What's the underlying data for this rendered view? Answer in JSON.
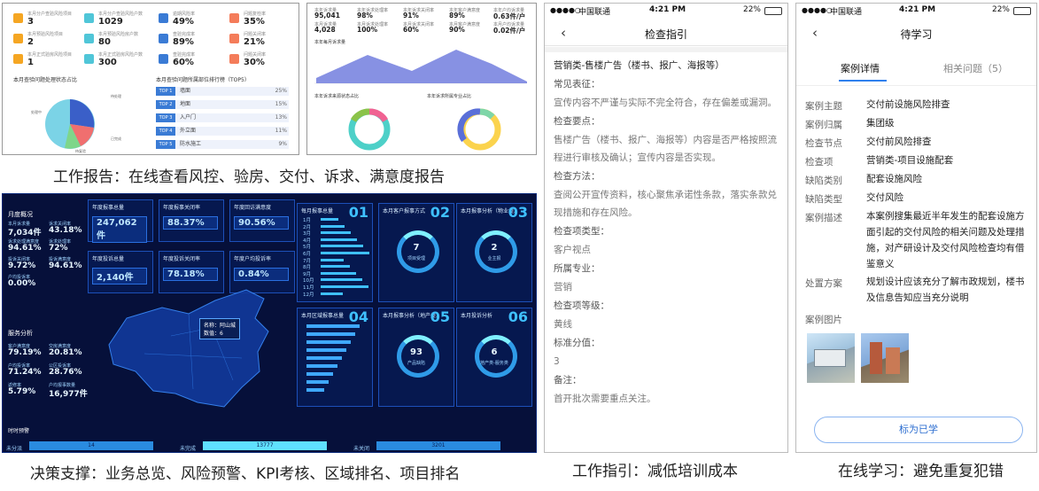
{
  "report_left": {
    "stats": [
      {
        "label": "本月分户查验风险项目",
        "value": "3",
        "color": "#f5a623"
      },
      {
        "label": "本月分户查验风险户数",
        "value": "1029",
        "color": "#50c6d8"
      },
      {
        "label": "逾期风险率",
        "value": "49%",
        "color": "#3a7bd5"
      },
      {
        "label": "问题复检率",
        "value": "35%",
        "color": "#f47c5a"
      },
      {
        "label": "本月预验风险项目",
        "value": "2",
        "color": "#f5a623"
      },
      {
        "label": "本月预验风险房户数",
        "value": "80",
        "color": "#50c6d8"
      },
      {
        "label": "查验完成率",
        "value": "89%",
        "color": "#3a7bd5"
      },
      {
        "label": "问题关闭率",
        "value": "21%",
        "color": "#f47c5a"
      },
      {
        "label": "本月正式验房风险项目",
        "value": "1",
        "color": "#f5a623"
      },
      {
        "label": "本月正式验房风险户数",
        "value": "300",
        "color": "#50c6d8"
      },
      {
        "label": "查验完成率",
        "value": "60%",
        "color": "#3a7bd5"
      },
      {
        "label": "问题关闭率",
        "value": "30%",
        "color": "#f47c5a"
      }
    ],
    "pie_title": "本月查验问题处理状态占比",
    "pie_labels": [
      "待处理",
      "已完成",
      "待复验",
      "处理中"
    ],
    "rank_title": "本月查验问题所属部位排行榜（TOP5）",
    "ranks": [
      {
        "badge": "TOP 1",
        "name": "墙面",
        "pct": "25%"
      },
      {
        "badge": "TOP 2",
        "name": "地面",
        "pct": "15%"
      },
      {
        "badge": "TOP 3",
        "name": "入户门",
        "pct": "13%"
      },
      {
        "badge": "TOP 4",
        "name": "外立面",
        "pct": "11%"
      },
      {
        "badge": "TOP 5",
        "name": "防水施工",
        "pct": "9%"
      }
    ]
  },
  "report_right": {
    "metrics": [
      {
        "label": "本年诉求量",
        "value": "95,041"
      },
      {
        "label": "本年诉求处理率",
        "value": "98%"
      },
      {
        "label": "本年诉求关闭率",
        "value": "91%"
      },
      {
        "label": "本年客户满意度",
        "value": "89%"
      },
      {
        "label": "本年户均诉求量",
        "value": "0.63件/户"
      },
      {
        "label": "本月诉求量",
        "value": "4,028"
      },
      {
        "label": "本月诉求处理率",
        "value": "100%"
      },
      {
        "label": "本月诉求关闭率",
        "value": "60%"
      },
      {
        "label": "本月客户满意度",
        "value": "90%"
      },
      {
        "label": "本月户均诉求量",
        "value": "0.02件/户"
      }
    ],
    "area_title": "本年每月诉求量",
    "donut1_title": "本年诉求来源状态占比",
    "donut2_title": "本年诉求所属专业占比"
  },
  "captions": {
    "report": "工作报告：在线查看风控、验房、交付、诉求、满意度报告",
    "dashboard": "决策支撑：业务总览、风险预警、KPI考核、区域排名、项目排名",
    "guide": "工作指引：减低培训成本",
    "study": "在线学习：避免重复犯错"
  },
  "dashboard": {
    "left_title": "月度概况",
    "left_items": [
      {
        "k": "本月诉求量",
        "v": "7,034件"
      },
      {
        "k": "诉求关闭率",
        "v": "43.18%"
      },
      {
        "k": "诉求处理满意度",
        "v": "94.61%"
      },
      {
        "k": "诉求处理率",
        "v": "72%"
      },
      {
        "k": "投诉关闭率",
        "v": "9.72%"
      },
      {
        "k": "投诉满意度",
        "v": "94.61%"
      },
      {
        "k": "户均投诉率",
        "v": "0.00%"
      }
    ],
    "analysis_title": "服务分析",
    "analysis_items": [
      {
        "k": "客户满意度",
        "v": "79.19%"
      },
      {
        "k": "交房满意度",
        "v": "20.81%"
      },
      {
        "k": "户均投诉率",
        "v": "71.24%"
      },
      {
        "k": "公区投诉率",
        "v": "28.76%"
      },
      {
        "k": "返修率",
        "v": "5.79%"
      },
      {
        "k": "户均报事数量",
        "v": "16,977件"
      }
    ],
    "kpis": [
      {
        "k": "年度报事总量",
        "v": "247,062件"
      },
      {
        "k": "年度报事关闭率",
        "v": "88.37%"
      },
      {
        "k": "年度回访满意度",
        "v": "90.56%"
      },
      {
        "k": "年度投诉总量",
        "v": "2,140件"
      },
      {
        "k": "年度投诉关闭率",
        "v": "78.18%"
      },
      {
        "k": "年度户均投诉率",
        "v": "0.84%"
      }
    ],
    "panels": [
      {
        "t": "每月报事总量",
        "n": "01"
      },
      {
        "t": "本月客户报事方式",
        "n": "02",
        "center": "7",
        "sub": "项目受理"
      },
      {
        "t": "本月报事分析（物业类）",
        "n": "03",
        "center": "2",
        "sub": "业主报"
      },
      {
        "t": "本月区域报事总量",
        "n": "04"
      },
      {
        "t": "本月报事分析（地产类）",
        "n": "05",
        "center": "93",
        "sub": "产品缺陷"
      },
      {
        "t": "本月投诉分析",
        "n": "06",
        "center": "6",
        "sub": "地产类-服务类"
      }
    ],
    "months": [
      "1月",
      "2月",
      "3月",
      "4月",
      "5月",
      "6月",
      "7月",
      "8月",
      "9月",
      "10月",
      "11月",
      "12月"
    ],
    "popup": {
      "name": "名称：阿山城",
      "value": "数值：6"
    },
    "bottom_title": "时时预警",
    "bottom": [
      {
        "k": "未分派",
        "v": "14"
      },
      {
        "k": "未完成",
        "v": "13777"
      },
      {
        "k": "未关闭",
        "v": "3201"
      }
    ]
  },
  "guide": {
    "status": {
      "carrier": "中国联通",
      "time": "4:21 PM",
      "battery": "22%"
    },
    "title": "检查指引",
    "blocks": [
      {
        "t": "营销类-售楼广告（楼书、报广、海报等）",
        "bold": true
      },
      {
        "t": "常见表征："
      },
      {
        "t": "宣传内容不严谨与实际不完全符合，存在偏差或漏洞。"
      },
      {
        "t": "检查要点："
      },
      {
        "t": "售楼广告（楼书、报广、海报等）内容是否严格按照流程进行审核及确认；宣传内容是否实现。"
      },
      {
        "t": "检查方法："
      },
      {
        "t": "查阅公开宣传资料，核心聚焦承诺性条款，落实条款兑现措施和存在风险。"
      },
      {
        "t": "检查项类型："
      },
      {
        "t": "客户视点"
      },
      {
        "t": "所属专业："
      },
      {
        "t": "营销"
      },
      {
        "t": "检查项等级："
      },
      {
        "t": "黄线"
      },
      {
        "t": "标准分值："
      },
      {
        "t": "3"
      },
      {
        "t": "备注："
      },
      {
        "t": "首开批次需要重点关注。"
      }
    ]
  },
  "study": {
    "status": {
      "carrier": "中国联通",
      "time": "4:21 PM",
      "battery": "22%"
    },
    "title": "待学习",
    "tabs": [
      "案例详情",
      "相关问题（5）"
    ],
    "rows": [
      {
        "k": "案例主题",
        "v": "交付前设施风险排查"
      },
      {
        "k": "案例归属",
        "v": "集团级"
      },
      {
        "k": "检查节点",
        "v": "交付前风险排查"
      },
      {
        "k": "检查项",
        "v": "营销类-项目设施配套"
      },
      {
        "k": "缺陷类别",
        "v": "配套设施风险"
      },
      {
        "k": "缺陷类型",
        "v": "交付风险"
      },
      {
        "k": "案例描述",
        "v": "本案例搜集最近半年发生的配套设施方面引起的交付风险的相关问题及处理措施，对产研设计及交付风险检查均有借鉴意义"
      },
      {
        "k": "处置方案",
        "v": "规划设计应该充分了解市政规划，楼书及信息告知应当充分说明"
      }
    ],
    "images_label": "案例图片",
    "button": "标为已学"
  }
}
